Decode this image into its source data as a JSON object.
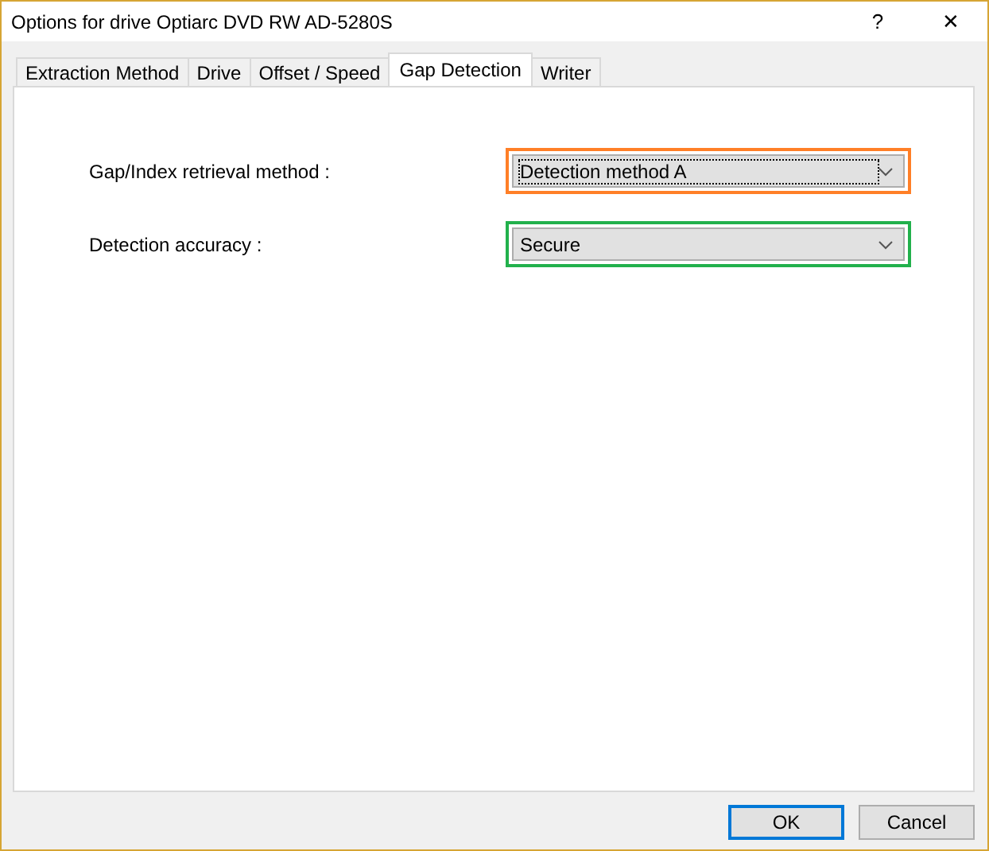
{
  "window": {
    "title": "Options for drive Optiarc DVD RW AD-5280S",
    "help": "?",
    "close": "✕"
  },
  "tabs": [
    {
      "label": "Extraction Method",
      "selected": false
    },
    {
      "label": "Drive",
      "selected": false
    },
    {
      "label": "Offset / Speed",
      "selected": false
    },
    {
      "label": "Gap Detection",
      "selected": true
    },
    {
      "label": "Writer",
      "selected": false
    }
  ],
  "settings": [
    {
      "label": "Gap/Index retrieval method :",
      "value": "Detection method A",
      "focused": true,
      "color": "#ff7f27"
    },
    {
      "label": "Detection accuracy :",
      "value": "Secure",
      "focused": false,
      "color": "#22b14c"
    }
  ],
  "buttons": [
    {
      "label": "OK",
      "default": true
    },
    {
      "label": "Cancel",
      "default": false
    }
  ]
}
